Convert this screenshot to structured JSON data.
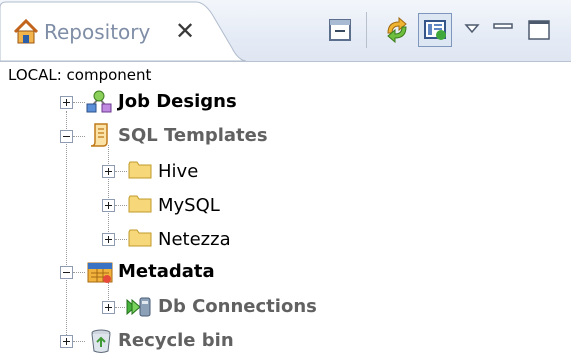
{
  "view": {
    "tab_title": "Repository",
    "tab_icon": "home-icon",
    "close_icon": "close-icon",
    "toolbar": [
      {
        "name": "collapse-all-button",
        "icon": "collapse-all-icon"
      },
      {
        "name": "refresh-button",
        "icon": "refresh-icon"
      },
      {
        "name": "filter-button",
        "icon": "filter-icon"
      },
      {
        "name": "view-menu-button",
        "icon": "view-menu-icon"
      },
      {
        "name": "minimize-button",
        "icon": "minimize-icon"
      },
      {
        "name": "maximize-button",
        "icon": "maximize-icon"
      }
    ]
  },
  "tree": {
    "root_label": "LOCAL: component",
    "nodes": [
      {
        "label": "Job Designs",
        "icon": "job-designs-icon",
        "state": "collapsed",
        "level": 1
      },
      {
        "label": "SQL Templates",
        "icon": "sql-templates-icon",
        "state": "expanded",
        "level": 1
      },
      {
        "label": "Hive",
        "icon": "folder-icon",
        "state": "collapsed",
        "level": 2
      },
      {
        "label": "MySQL",
        "icon": "folder-icon",
        "state": "collapsed",
        "level": 2
      },
      {
        "label": "Netezza",
        "icon": "folder-icon",
        "state": "collapsed",
        "level": 2
      },
      {
        "label": "Metadata",
        "icon": "metadata-icon",
        "state": "expanded",
        "level": 1
      },
      {
        "label": "Db Connections",
        "icon": "db-connections-icon",
        "state": "collapsed",
        "level": 2
      },
      {
        "label": "Recycle bin",
        "icon": "recycle-bin-icon",
        "state": "collapsed",
        "level": 1
      }
    ]
  },
  "colors": {
    "tab_title": "#7f8ea6",
    "folder_fill": "#f6d77a",
    "bold_label_dark": "#000000",
    "bold_label_gray": "#616161"
  }
}
